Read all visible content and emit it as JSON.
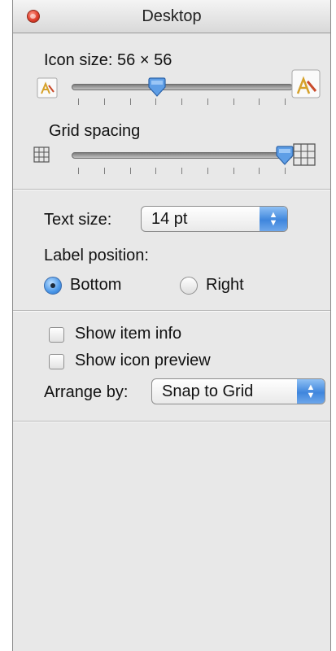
{
  "window": {
    "title": "Desktop"
  },
  "icon_size": {
    "label": "Icon size: 56 × 56",
    "slider_fraction": 0.38,
    "tick_count": 9
  },
  "grid_spacing": {
    "label": "Grid spacing",
    "slider_fraction": 1.0,
    "tick_count": 9
  },
  "text_size": {
    "label": "Text size:",
    "value": "14 pt"
  },
  "label_position": {
    "label": "Label position:",
    "options": [
      {
        "label": "Bottom",
        "selected": true
      },
      {
        "label": "Right",
        "selected": false
      }
    ]
  },
  "options": {
    "show_item_info": {
      "label": "Show item info",
      "checked": false
    },
    "show_icon_preview": {
      "label": "Show icon preview",
      "checked": false
    }
  },
  "arrange_by": {
    "label": "Arrange by:",
    "value": "Snap to Grid"
  },
  "colors": {
    "accent": "#3f86dd",
    "close": "#e0412f",
    "panel": "#e8e8e8"
  }
}
